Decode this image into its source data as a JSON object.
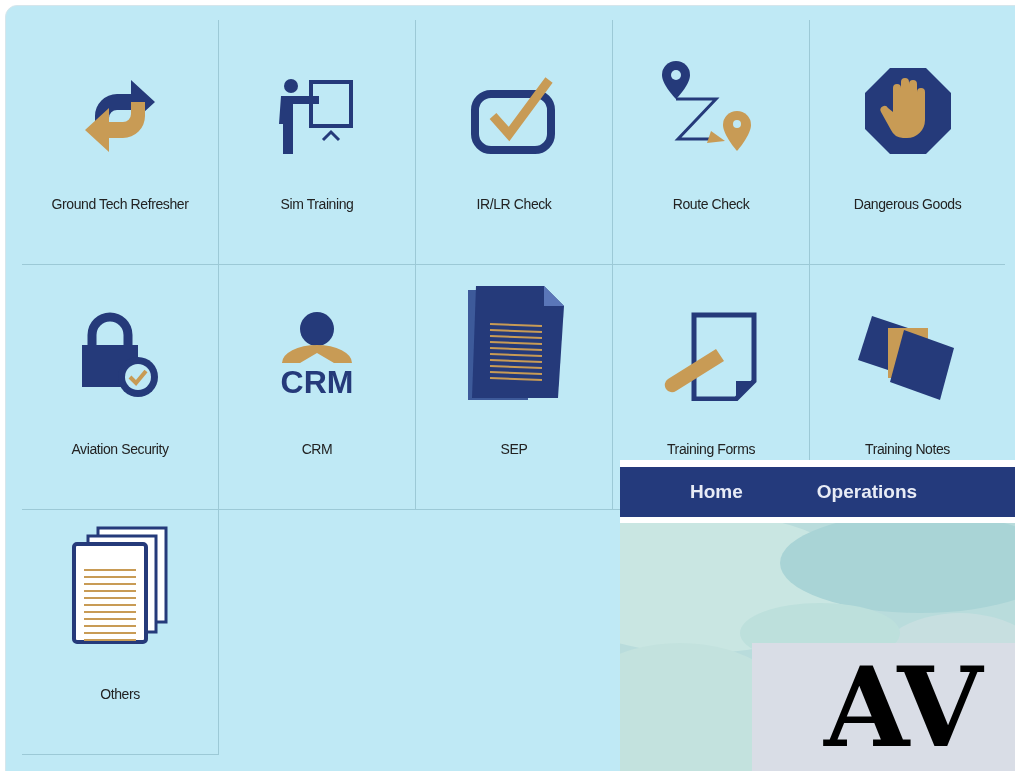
{
  "tiles": [
    {
      "label": "Ground Tech Refresher"
    },
    {
      "label": "Sim Training"
    },
    {
      "label": "IR/LR Check"
    },
    {
      "label": "Route Check"
    },
    {
      "label": "Dangerous Goods"
    },
    {
      "label": "Aviation Security"
    },
    {
      "label": "CRM",
      "icon_text": "CRM"
    },
    {
      "label": "SEP"
    },
    {
      "label": "Training Forms"
    },
    {
      "label": "Training Notes"
    },
    {
      "label": "Others"
    }
  ],
  "overlay": {
    "nav": [
      "Home",
      "Operations"
    ],
    "hero": {
      "kind": "picture",
      "heading": "AV"
    }
  }
}
